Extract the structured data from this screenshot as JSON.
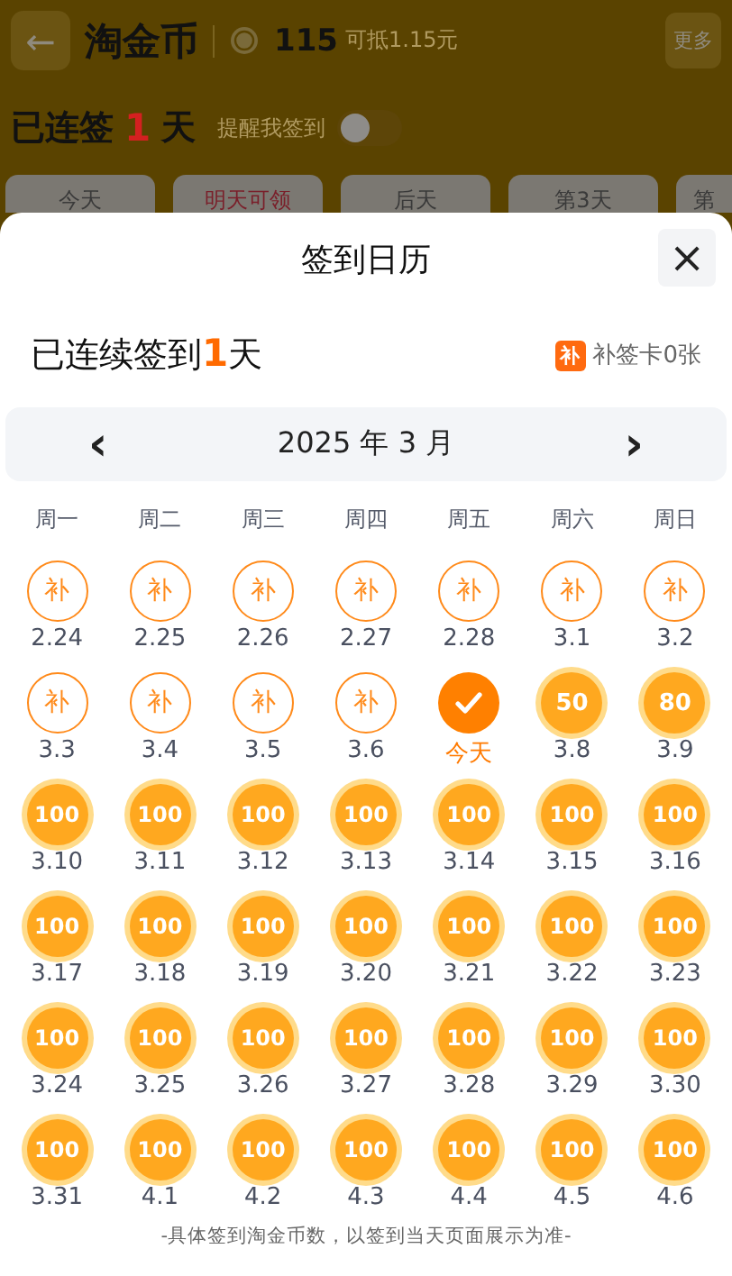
{
  "background_page": {
    "back_button": "←",
    "title": "淘金币",
    "coins": "115",
    "coin_value": "可抵1.15元",
    "more_button": "更多",
    "streak": {
      "prefix": "已连签",
      "days": "1",
      "suffix": "天"
    },
    "reminder": {
      "label": "提醒我签到",
      "on": false
    },
    "tabs": [
      {
        "label": "今天",
        "highlight": false
      },
      {
        "label": "明天可领",
        "highlight": true
      },
      {
        "label": "后天",
        "highlight": false
      },
      {
        "label": "第3天",
        "highlight": false
      },
      {
        "label": "第",
        "highlight": false
      }
    ]
  },
  "sheet": {
    "title": "签到日历",
    "close_button": "×",
    "streak": {
      "prefix": "已连续签到",
      "days": "1",
      "suffix": "天"
    },
    "makeup_card": {
      "icon": "补",
      "label": "补签卡0张"
    },
    "month": {
      "label": "2025 年 3 月",
      "prev": "‹",
      "next": "›"
    },
    "weekdays": [
      "周一",
      "周二",
      "周三",
      "周四",
      "周五",
      "周六",
      "周日"
    ],
    "days": [
      {
        "kind": "makeup",
        "mark": "补",
        "label": "2.24"
      },
      {
        "kind": "makeup",
        "mark": "补",
        "label": "2.25"
      },
      {
        "kind": "makeup",
        "mark": "补",
        "label": "2.26"
      },
      {
        "kind": "makeup",
        "mark": "补",
        "label": "2.27"
      },
      {
        "kind": "makeup",
        "mark": "补",
        "label": "2.28"
      },
      {
        "kind": "makeup",
        "mark": "补",
        "label": "3.1"
      },
      {
        "kind": "makeup",
        "mark": "补",
        "label": "3.2"
      },
      {
        "kind": "makeup",
        "mark": "补",
        "label": "3.3"
      },
      {
        "kind": "makeup",
        "mark": "补",
        "label": "3.4"
      },
      {
        "kind": "makeup",
        "mark": "补",
        "label": "3.5"
      },
      {
        "kind": "makeup",
        "mark": "补",
        "label": "3.6"
      },
      {
        "kind": "signed",
        "label": "今天"
      },
      {
        "kind": "coin",
        "mark": "50",
        "label": "3.8"
      },
      {
        "kind": "coin",
        "mark": "80",
        "label": "3.9"
      },
      {
        "kind": "coin",
        "mark": "100",
        "label": "3.10"
      },
      {
        "kind": "coin",
        "mark": "100",
        "label": "3.11"
      },
      {
        "kind": "coin",
        "mark": "100",
        "label": "3.12"
      },
      {
        "kind": "coin",
        "mark": "100",
        "label": "3.13"
      },
      {
        "kind": "coin",
        "mark": "100",
        "label": "3.14"
      },
      {
        "kind": "coin",
        "mark": "100",
        "label": "3.15"
      },
      {
        "kind": "coin",
        "mark": "100",
        "label": "3.16"
      },
      {
        "kind": "coin",
        "mark": "100",
        "label": "3.17"
      },
      {
        "kind": "coin",
        "mark": "100",
        "label": "3.18"
      },
      {
        "kind": "coin",
        "mark": "100",
        "label": "3.19"
      },
      {
        "kind": "coin",
        "mark": "100",
        "label": "3.20"
      },
      {
        "kind": "coin",
        "mark": "100",
        "label": "3.21"
      },
      {
        "kind": "coin",
        "mark": "100",
        "label": "3.22"
      },
      {
        "kind": "coin",
        "mark": "100",
        "label": "3.23"
      },
      {
        "kind": "coin",
        "mark": "100",
        "label": "3.24"
      },
      {
        "kind": "coin",
        "mark": "100",
        "label": "3.25"
      },
      {
        "kind": "coin",
        "mark": "100",
        "label": "3.26"
      },
      {
        "kind": "coin",
        "mark": "100",
        "label": "3.27"
      },
      {
        "kind": "coin",
        "mark": "100",
        "label": "3.28"
      },
      {
        "kind": "coin",
        "mark": "100",
        "label": "3.29"
      },
      {
        "kind": "coin",
        "mark": "100",
        "label": "3.30"
      },
      {
        "kind": "coin",
        "mark": "100",
        "label": "3.31"
      },
      {
        "kind": "coin",
        "mark": "100",
        "label": "4.1"
      },
      {
        "kind": "coin",
        "mark": "100",
        "label": "4.2"
      },
      {
        "kind": "coin",
        "mark": "100",
        "label": "4.3"
      },
      {
        "kind": "coin",
        "mark": "100",
        "label": "4.4"
      },
      {
        "kind": "coin",
        "mark": "100",
        "label": "4.5"
      },
      {
        "kind": "coin",
        "mark": "100",
        "label": "4.6"
      }
    ],
    "footnote": "-具体签到淘金币数，以签到当天页面展示为准-"
  }
}
